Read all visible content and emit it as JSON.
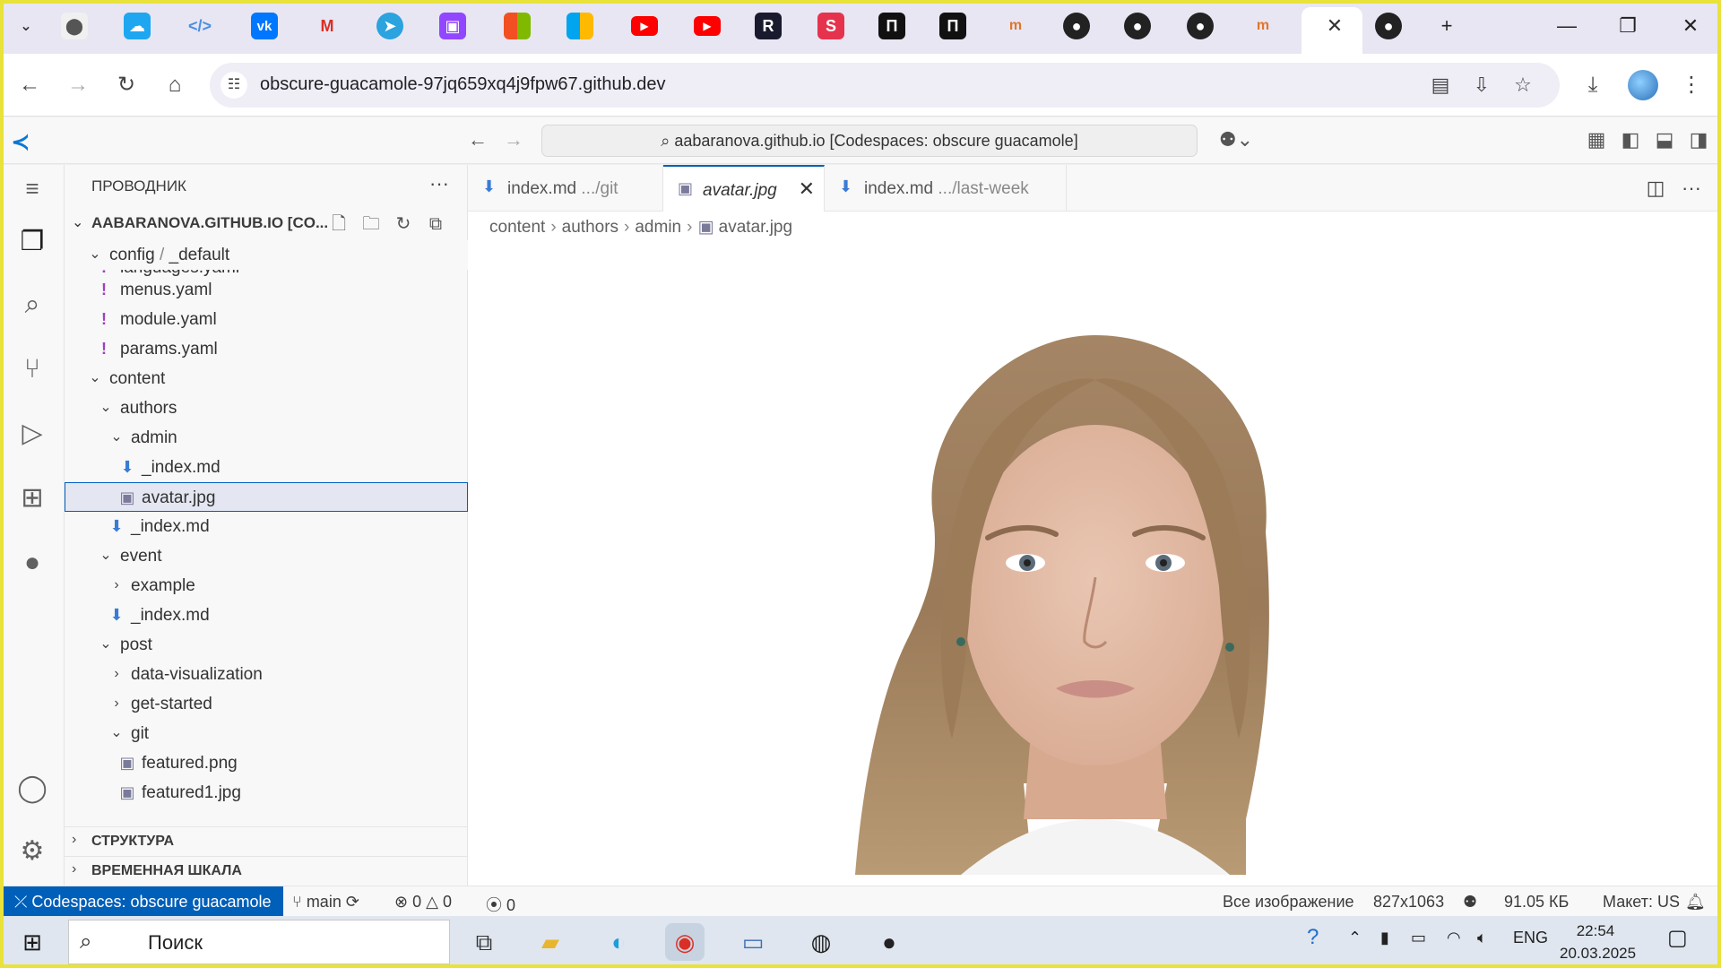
{
  "browser": {
    "url": "obscure-guacamole-97jq659xq4j9fpw67.github.dev",
    "active_tab_close": "✕",
    "new_tab": "+",
    "window_controls": {
      "minimize": "—",
      "maximize": "❐",
      "close": "✕"
    }
  },
  "vscode": {
    "command_center": "aabaranova.github.io [Codespaces: obscure guacamole]",
    "explorer_title": "ПРОВОДНИК",
    "workspace_name": "AABARANOVA.GITHUB.IO [CO...",
    "tree": [
      {
        "label": "config",
        "sep": " / ",
        "label2": "_default",
        "chev": "⌄",
        "icon": ""
      },
      {
        "label": "languages.yaml",
        "icon": "!"
      },
      {
        "label": "menus.yaml",
        "icon": "!"
      },
      {
        "label": "module.yaml",
        "icon": "!"
      },
      {
        "label": "params.yaml",
        "icon": "!"
      },
      {
        "label": "content",
        "chev": "⌄"
      },
      {
        "label": "authors",
        "chev": "⌄"
      },
      {
        "label": "admin",
        "chev": "⌄"
      },
      {
        "label": "_index.md",
        "icon": "⬇"
      },
      {
        "label": "avatar.jpg",
        "icon": "▣"
      },
      {
        "label": "_index.md",
        "icon": "⬇"
      },
      {
        "label": "event",
        "chev": "⌄"
      },
      {
        "label": "example",
        "chev": "›"
      },
      {
        "label": "_index.md",
        "icon": "⬇"
      },
      {
        "label": "post",
        "chev": "⌄"
      },
      {
        "label": "data-visualization",
        "chev": "›"
      },
      {
        "label": "get-started",
        "chev": "›"
      },
      {
        "label": "git",
        "chev": "⌄"
      },
      {
        "label": "featured.png",
        "icon": "▣"
      },
      {
        "label": "featured1.jpg",
        "icon": "▣"
      }
    ],
    "sections": {
      "outline": "СТРУКТУРА",
      "timeline": "ВРЕМЕННАЯ ШКАЛА"
    },
    "tabs": [
      {
        "name": "index.md",
        "desc": ".../git"
      },
      {
        "name": "avatar.jpg",
        "desc": ""
      },
      {
        "name": "index.md",
        "desc": ".../last-week"
      }
    ],
    "breadcrumbs": [
      "content",
      "authors",
      "admin",
      "avatar.jpg"
    ],
    "status": {
      "remote": "Codespaces: obscure guacamole",
      "branch": "main",
      "errors": "0",
      "warnings": "0",
      "ports": "0",
      "zoom": "Все изображение",
      "dimensions": "827x1063",
      "size": "91.05 КБ",
      "layout": "Макет: US"
    }
  },
  "taskbar": {
    "search": "Поиск",
    "lang": "ENG",
    "time": "22:54",
    "date": "20.03.2025"
  },
  "colors": {
    "accent": "#005fb8",
    "vscode_blue": "#0a78d4",
    "highlight_border": "#e8e23a"
  }
}
